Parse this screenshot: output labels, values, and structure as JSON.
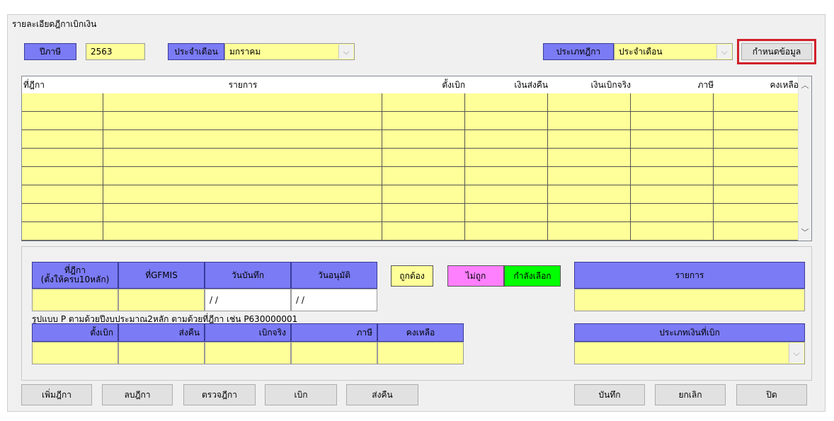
{
  "window": {
    "title": "รายละเอียดฎีกาเบิกเงิน"
  },
  "top": {
    "year_label": "ปีภาษี",
    "year_value": "2563",
    "month_label": "ประจำเดือน",
    "month_value": "มกราคม",
    "type_label": "ประเภทฎีกา",
    "type_value": "ประจำเดือน",
    "set_data_button": "กำหนดข้อมูล"
  },
  "grid": {
    "columns": [
      "ที่ฎีกา",
      "รายการ",
      "ตั้งเบิก",
      "เงินส่งคืน",
      "เงินเบิกจริง",
      "ภาษี",
      "คงเหลือ"
    ],
    "empty_rows": 8
  },
  "detail": {
    "headers": {
      "doc_no_line1": "ที่ฎีกา",
      "doc_no_line2": "(ตั้งให้ครบ10หลัก)",
      "gfmis": "ที่GFMIS",
      "record_date": "วันบันทึก",
      "approve_date": "วันอนุมัติ",
      "item": "รายการ"
    },
    "record_date_value": "/ /",
    "approve_date_value": "/ /",
    "format_note": "รูปแบบ  P ตามด้วยปีงบประมาณ2หลัก ตามด้วยที่ฎีกา   เช่น  P630000001",
    "amount_headers": [
      "ตั้งเบิก",
      "ส่งคืน",
      "เบิกจริง",
      "ภาษี",
      "คงเหลือ"
    ],
    "payment_type_label": "ประเภทเงินที่เบิก"
  },
  "legend": {
    "correct": "ถูกต้อง",
    "incorrect": "ไม่ถูก",
    "selecting": "กำลังเลือก",
    "colors": {
      "correct": "#ffff99",
      "incorrect": "#ff80ff",
      "selecting": "#00ff00"
    }
  },
  "buttons": {
    "add": "เพิ่มฎีกา",
    "delete": "ลบฎีกา",
    "check": "ตรวจฎีกา",
    "withdraw": "เบิก",
    "refund": "ส่งคืน",
    "save": "บันทึก",
    "cancel": "ยกเลิก",
    "close": "ปิด"
  },
  "icons": {
    "combo_arrow": "chevron-down-icon",
    "scroll_up": "chevron-up-icon",
    "scroll_down": "chevron-down-icon"
  }
}
